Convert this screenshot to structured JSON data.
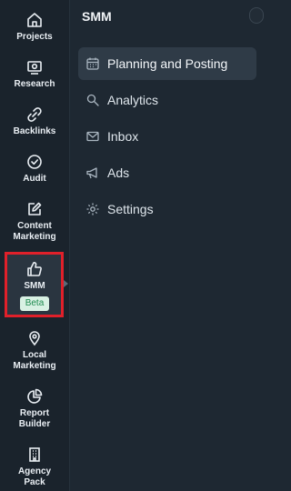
{
  "rail": {
    "items": [
      {
        "label": "Projects",
        "icon": "home-icon"
      },
      {
        "label": "Research",
        "icon": "screen-search-icon"
      },
      {
        "label": "Backlinks",
        "icon": "link-icon"
      },
      {
        "label": "Audit",
        "icon": "check-circle-icon"
      },
      {
        "label": "Content\nMarketing",
        "icon": "edit-icon"
      },
      {
        "label": "SMM",
        "icon": "thumbs-up-icon",
        "badge": "Beta",
        "active": true
      },
      {
        "label": "Local\nMarketing",
        "icon": "location-pin-icon"
      },
      {
        "label": "Report\nBuilder",
        "icon": "pie-chart-icon"
      },
      {
        "label": "Agency\nPack",
        "icon": "building-icon"
      }
    ]
  },
  "panel": {
    "title": "SMM",
    "menu": [
      {
        "label": "Planning and Posting",
        "icon": "calendar-icon",
        "active": true
      },
      {
        "label": "Analytics",
        "icon": "search-analytics-icon"
      },
      {
        "label": "Inbox",
        "icon": "mail-icon"
      },
      {
        "label": "Ads",
        "icon": "megaphone-icon"
      },
      {
        "label": "Settings",
        "icon": "gear-icon"
      }
    ]
  },
  "colors": {
    "background": "#1e2832",
    "rail": "#1a232c",
    "active_menu": "#2f3b47",
    "highlight_border": "#e0202a",
    "beta_bg": "#d8f1e3",
    "beta_text": "#1e8b4f"
  }
}
